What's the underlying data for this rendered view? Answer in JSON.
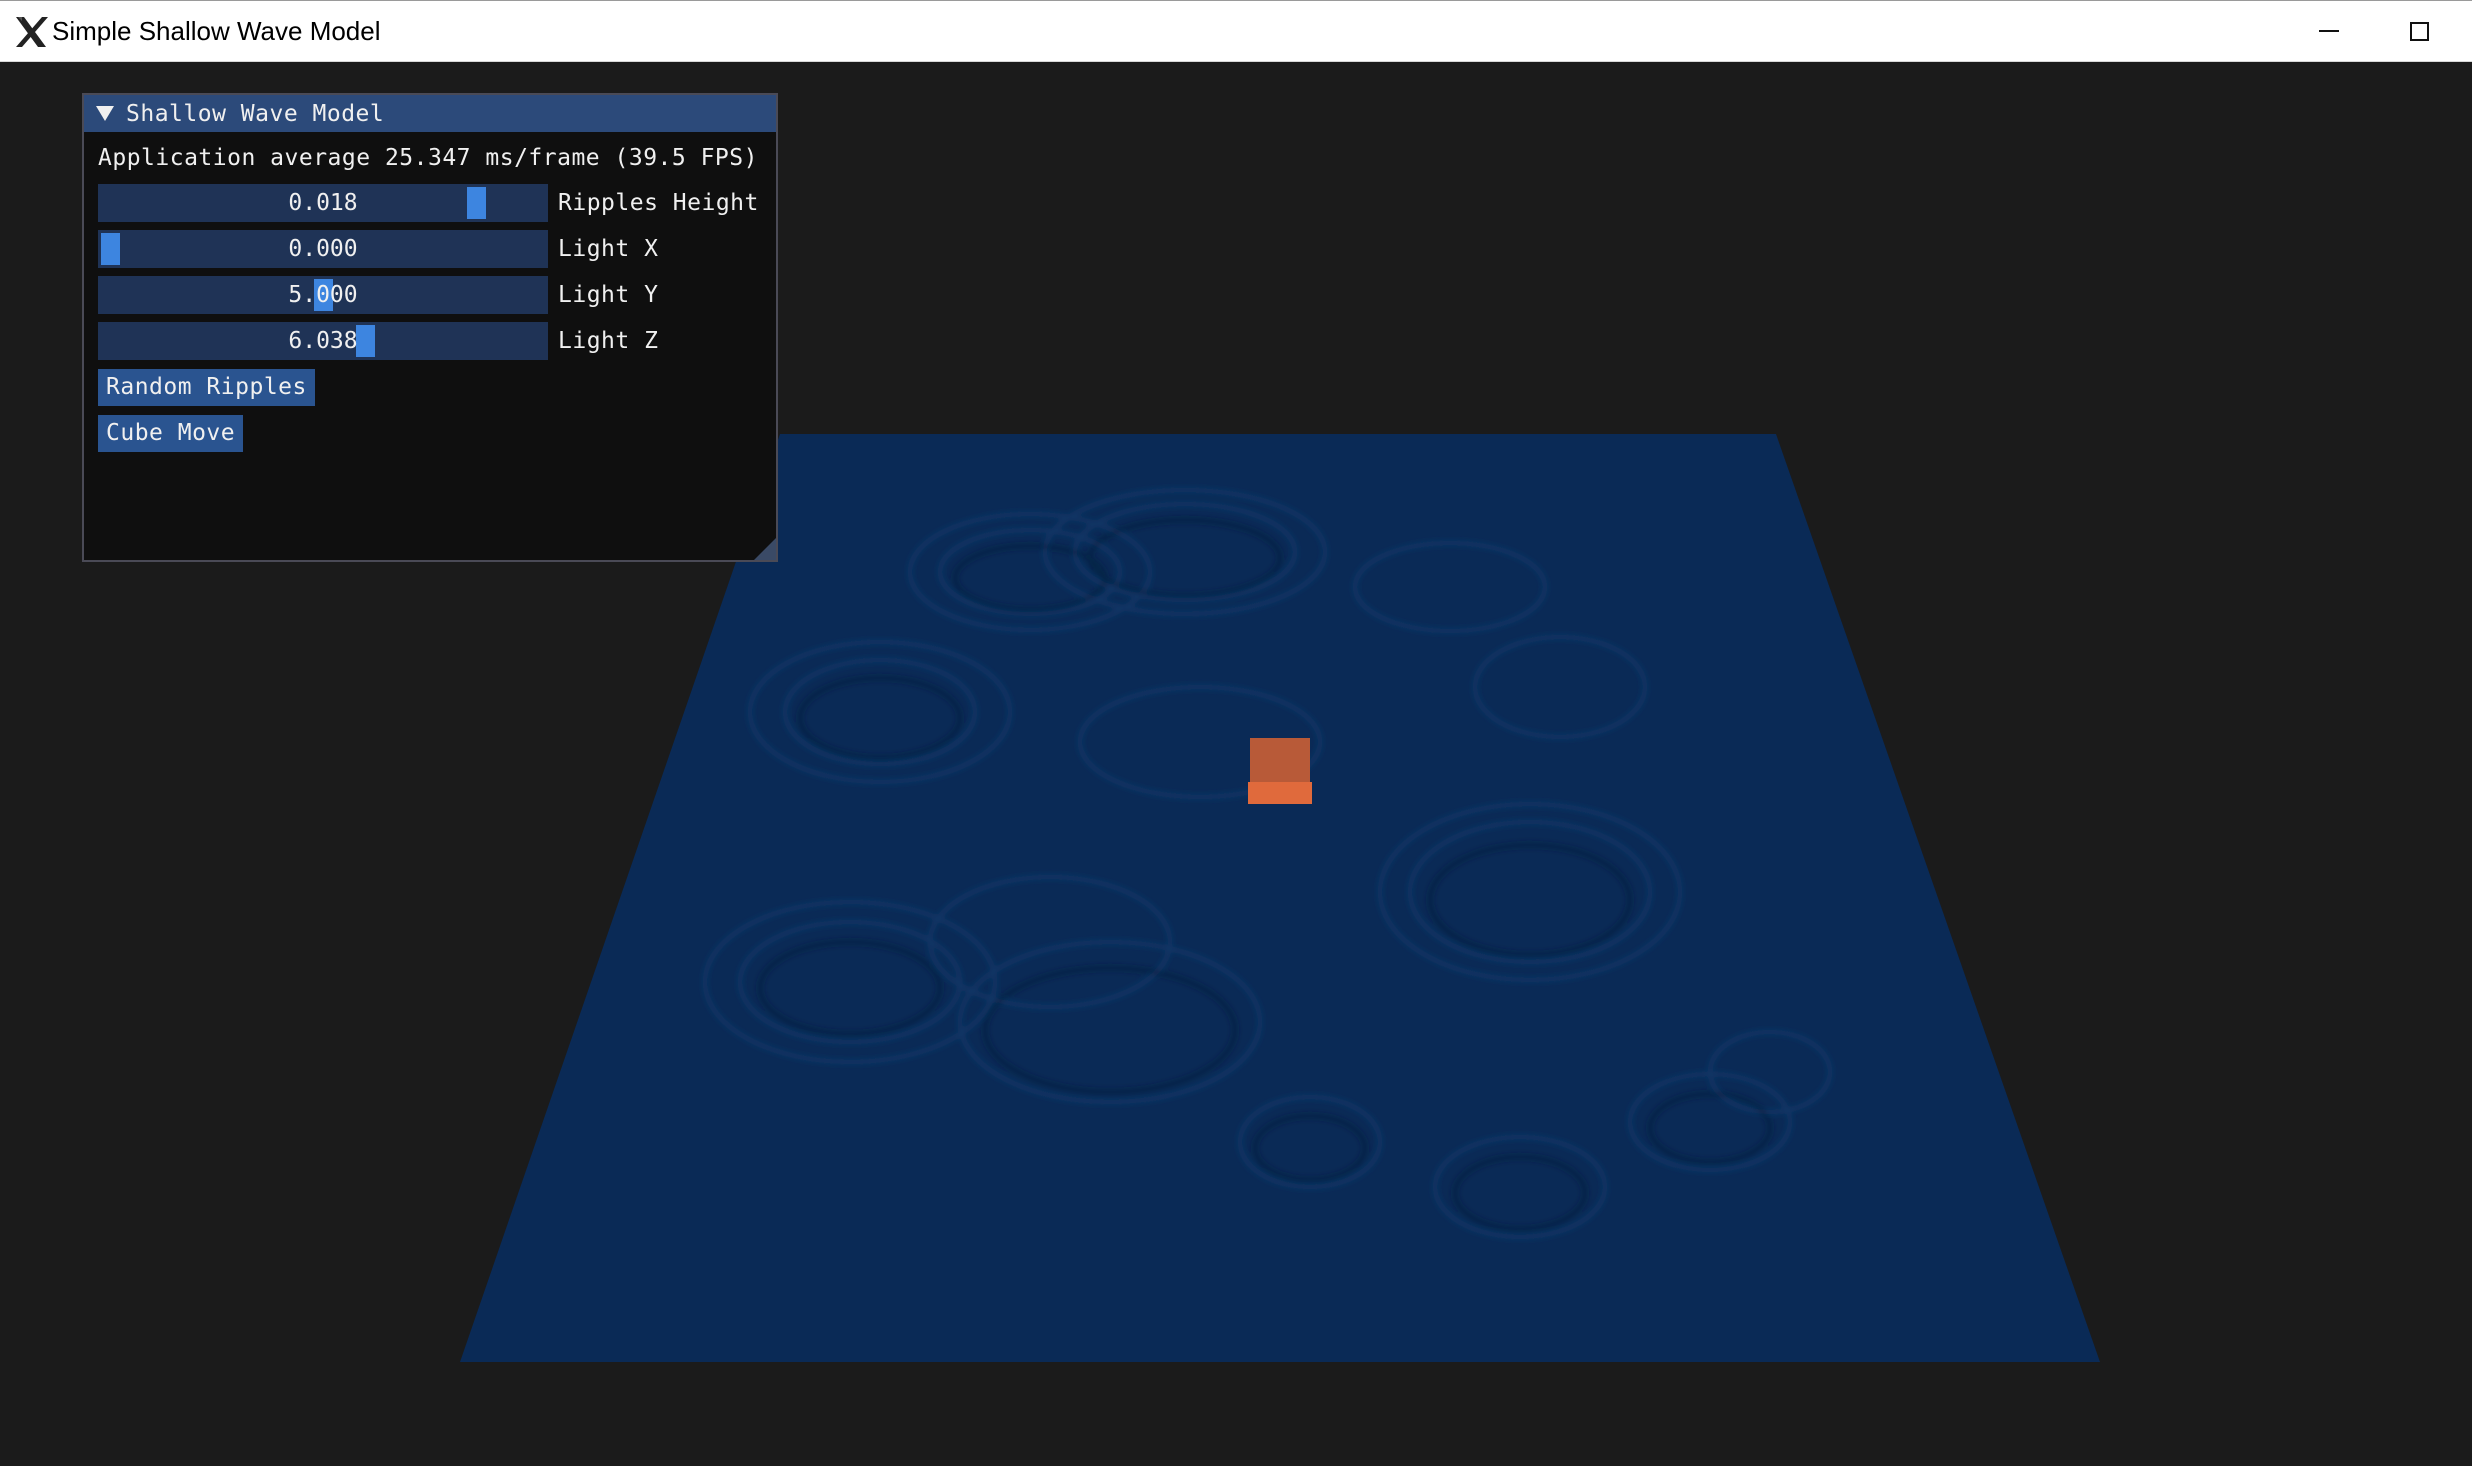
{
  "window": {
    "title": "Simple Shallow Wave Model",
    "app_icon": "x-logo-icon",
    "controls": [
      "minimize-icon",
      "maximize-icon"
    ]
  },
  "panel": {
    "title": "Shallow Wave Model",
    "stats": "Application average 25.347 ms/frame (39.5 FPS)",
    "sliders": [
      {
        "label": "Ripples Height",
        "value": "0.018",
        "fraction": 0.86
      },
      {
        "label": "Light X",
        "value": "0.000",
        "fraction": 0.0
      },
      {
        "label": "Light Y",
        "value": "5.000",
        "fraction": 0.5
      },
      {
        "label": "Light Z",
        "value": "6.038",
        "fraction": 0.6
      }
    ],
    "buttons": [
      {
        "label": "Random Ripples"
      },
      {
        "label": "Cube Move"
      }
    ]
  },
  "scene": {
    "background": "#1b1b1b",
    "water_color": "#0a2a56",
    "cube_color": "#d2633a"
  }
}
